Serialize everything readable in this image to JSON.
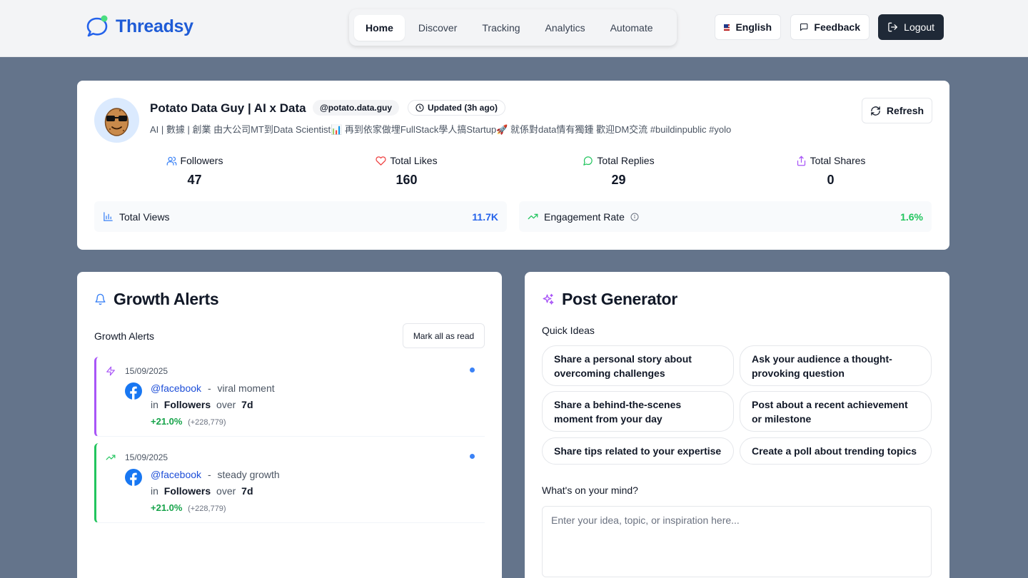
{
  "app": {
    "name": "Threadsy"
  },
  "nav": {
    "items": [
      {
        "label": "Home",
        "active": true
      },
      {
        "label": "Discover"
      },
      {
        "label": "Tracking"
      },
      {
        "label": "Analytics"
      },
      {
        "label": "Automate"
      }
    ]
  },
  "header": {
    "language": "English",
    "feedback": "Feedback",
    "logout": "Logout"
  },
  "profile": {
    "name": "Potato Data Guy | AI x Data",
    "handle": "@potato.data.guy",
    "updated": "Updated (3h ago)",
    "bio": "AI | 數據 | 創業 由大公司MT到Data Scientist📊 再到依家做埋FullStack學人搞Startup🚀 就係對data情有獨鍾 歡迎DM交流 #buildinpublic #yolo",
    "refresh": "Refresh",
    "stats": [
      {
        "label": "Followers",
        "value": "47",
        "icon": "users-icon",
        "color": "#3b82f6"
      },
      {
        "label": "Total Likes",
        "value": "160",
        "icon": "heart-icon",
        "color": "#ef4444"
      },
      {
        "label": "Total Replies",
        "value": "29",
        "icon": "message-circle-icon",
        "color": "#22c55e"
      },
      {
        "label": "Total Shares",
        "value": "0",
        "icon": "share-icon",
        "color": "#a855f7"
      }
    ],
    "total_views": {
      "label": "Total Views",
      "value": "11.7K",
      "color": "#2563eb"
    },
    "engagement": {
      "label": "Engagement Rate",
      "value": "1.6%",
      "color": "#22c55e"
    }
  },
  "alerts": {
    "title": "Growth Alerts",
    "subtitle": "Growth Alerts",
    "mark_all": "Mark all as read",
    "items": [
      {
        "date": "15/09/2025",
        "account": "@facebook",
        "sep": "-",
        "type": "viral moment",
        "in": "in",
        "metric": "Followers",
        "over": "over",
        "period": "7d",
        "pct": "+21.0%",
        "abs": "(+228,779)",
        "color": "#a855f7",
        "icon": "zap-icon"
      },
      {
        "date": "15/09/2025",
        "account": "@facebook",
        "sep": "-",
        "type": "steady growth",
        "in": "in",
        "metric": "Followers",
        "over": "over",
        "period": "7d",
        "pct": "+21.0%",
        "abs": "(+228,779)",
        "color": "#22c55e",
        "icon": "trending-up-icon"
      }
    ]
  },
  "generator": {
    "title": "Post Generator",
    "quick_ideas_label": "Quick Ideas",
    "ideas": [
      "Share a personal story about overcoming challenges",
      "Ask your audience a thought-provoking question",
      "Share a behind-the-scenes moment from your day",
      "Post about a recent achievement or milestone",
      "Share tips related to your expertise",
      "Create a poll about trending topics"
    ],
    "mind_label": "What's on your mind?",
    "placeholder": "Enter your idea, topic, or inspiration here..."
  }
}
